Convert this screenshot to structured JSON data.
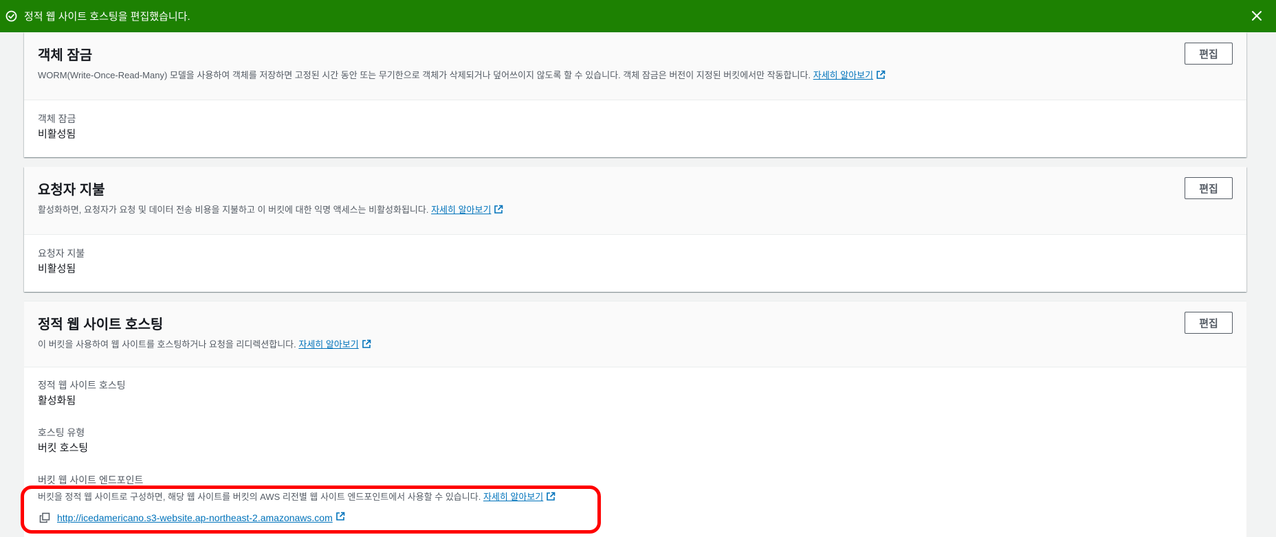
{
  "flash": {
    "message": "정적 웹 사이트 호스팅을 편집했습니다.",
    "icon": "success-check-icon",
    "close_icon": "close-icon",
    "color": "#1d8102"
  },
  "object_lock": {
    "title": "객체 잠금",
    "description": "WORM(Write-Once-Read-Many) 모델을 사용하여 객체를 저장하면 고정된 시간 동안 또는 무기한으로 객체가 삭제되거나 덮어쓰이지 않도록 할 수 있습니다. 객체 잠금은 버전이 지정된 버킷에서만 작동합니다.",
    "learn_more": "자세히 알아보기",
    "edit_label": "편집",
    "field_label": "객체 잠금",
    "field_value": "비활성됨"
  },
  "requester_pays": {
    "title": "요청자 지불",
    "description": "활성화하면, 요청자가 요청 및 데이터 전송 비용을 지불하고 이 버킷에 대한 익명 액세스는 비활성화됩니다.",
    "learn_more": "자세히 알아보기",
    "edit_label": "편집",
    "field_label": "요청자 지불",
    "field_value": "비활성됨"
  },
  "static_hosting": {
    "title": "정적 웹 사이트 호스팅",
    "description": "이 버킷을 사용하여 웹 사이트를 호스팅하거나 요청을 리디렉션합니다.",
    "learn_more": "자세히 알아보기",
    "edit_label": "편집",
    "hosting_label": "정적 웹 사이트 호스팅",
    "hosting_value": "활성화됨",
    "type_label": "호스팅 유형",
    "type_value": "버킷 호스팅",
    "endpoint_label": "버킷 웹 사이트 엔드포인트",
    "endpoint_desc": "버킷을 정적 웹 사이트로 구성하면, 해당 웹 사이트를 버킷의 AWS 리전별 웹 사이트 엔드포인트에서 사용할 수 있습니다.",
    "endpoint_learn_more": "자세히 알아보기",
    "endpoint_url": "http://icedamericano.s3-website.ap-northeast-2.amazonaws.com"
  },
  "colors": {
    "link": "#0073bb",
    "highlight": "#ff0000"
  }
}
